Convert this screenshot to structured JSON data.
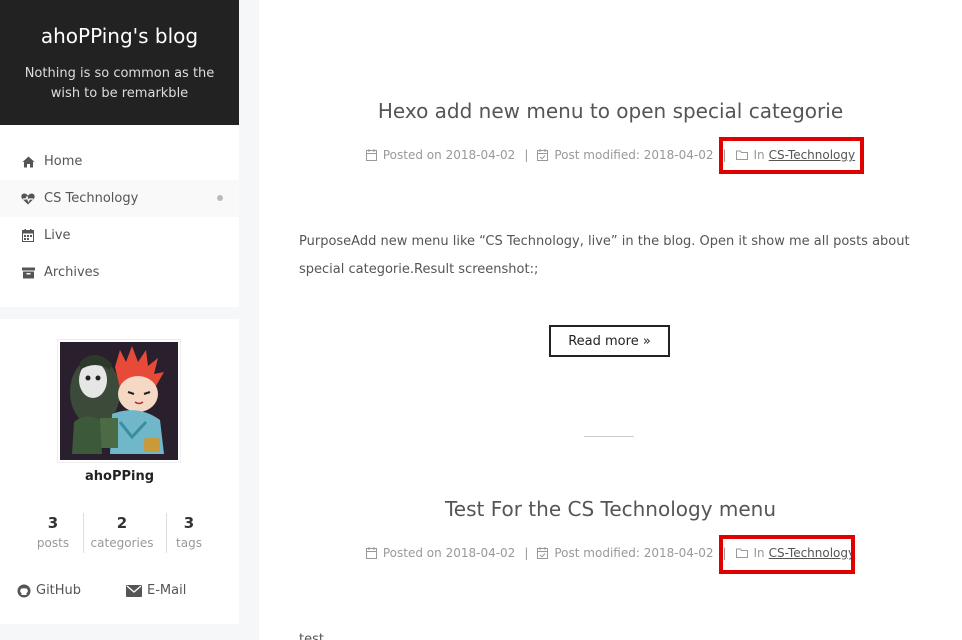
{
  "site": {
    "title": "ahoPPing's blog",
    "subtitle": "Nothing is so common as the wish to be remarkble"
  },
  "menu": [
    {
      "label": "Home",
      "icon": "home-icon",
      "active": false
    },
    {
      "label": "CS Technology",
      "icon": "heartbeat-icon",
      "active": true
    },
    {
      "label": "Live",
      "icon": "calendar-icon",
      "active": false
    },
    {
      "label": "Archives",
      "icon": "archive-icon",
      "active": false
    }
  ],
  "profile": {
    "author": "ahoPPing",
    "stats": [
      {
        "count": "3",
        "label": "posts"
      },
      {
        "count": "2",
        "label": "categories"
      },
      {
        "count": "3",
        "label": "tags"
      }
    ],
    "links": [
      {
        "label": "GitHub",
        "icon": "github-icon"
      },
      {
        "label": "E-Mail",
        "icon": "envelope-icon"
      }
    ]
  },
  "posts": [
    {
      "title": "Hexo add new menu to open special categorie",
      "posted_label": "Posted on",
      "posted_date": "2018-04-02",
      "modified_label": "Post modified:",
      "modified_date": "2018-04-02",
      "in_label": "In",
      "category": "CS-Technology",
      "excerpt": "PurposeAdd new menu like “CS Technology, live” in the blog. Open it show me all posts about special categorie.Result screenshot:;",
      "read_more": "Read more »"
    },
    {
      "title": "Test For the CS Technology menu",
      "posted_label": "Posted on",
      "posted_date": "2018-04-02",
      "modified_label": "Post modified:",
      "modified_date": "2018-04-02",
      "in_label": "In",
      "category": "CS-Technology",
      "excerpt": "test"
    }
  ],
  "colors": {
    "header_bg": "#222222",
    "highlight": "#e00000",
    "page_bg": "#f5f7f9"
  }
}
